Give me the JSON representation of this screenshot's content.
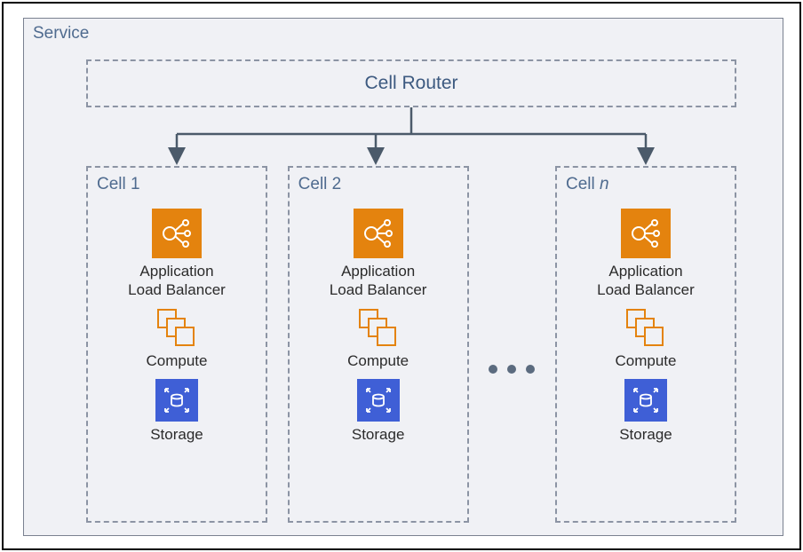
{
  "service": {
    "label": "Service"
  },
  "router": {
    "label": "Cell Router"
  },
  "ellipsis_name": "ellipsis",
  "cells": [
    {
      "label_prefix": "Cell ",
      "label_num": "1",
      "italic": false
    },
    {
      "label_prefix": "Cell ",
      "label_num": "2",
      "italic": false
    },
    {
      "label_prefix": "Cell ",
      "label_num": "n",
      "italic": true
    }
  ],
  "components": {
    "alb": {
      "line1": "Application",
      "line2": "Load Balancer",
      "icon_name": "load-balancer-icon"
    },
    "compute": {
      "label": "Compute",
      "icon_name": "compute-icon"
    },
    "storage": {
      "label": "Storage",
      "icon_name": "storage-icon"
    }
  }
}
